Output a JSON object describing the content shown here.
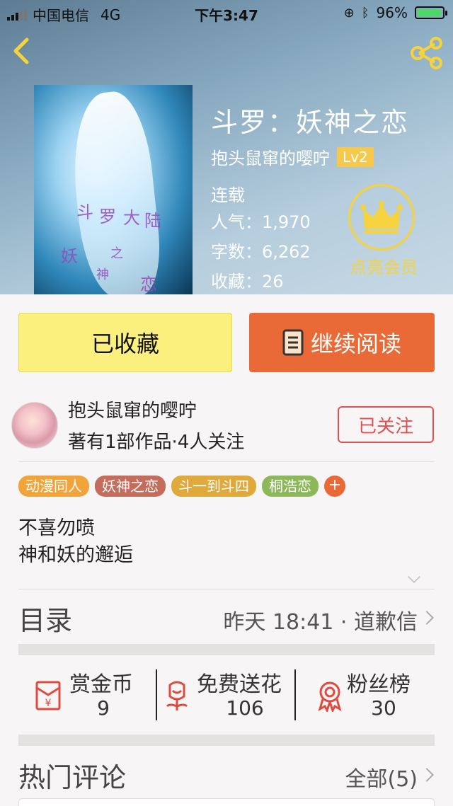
{
  "status_bar": {
    "carrier": "中国电信",
    "network": "4G",
    "time": "下午3:47",
    "battery": "96%",
    "battery_level": 0.96
  },
  "book": {
    "title": "斗罗：妖神之恋",
    "author": "抱头鼠窜的嘤咛",
    "level": "Lv2",
    "status": "连载",
    "popularity": "人气：1,970",
    "words": "字数：6,262",
    "favorites": "收藏：26",
    "vip_label": "点亮会员",
    "cover_text": [
      "斗",
      "罗",
      "大",
      "陆",
      "妖",
      "神",
      "之",
      "恋"
    ]
  },
  "actions": {
    "favorite": "已收藏",
    "continue": "继续阅读"
  },
  "author_card": {
    "name": "抱头鼠窜的嘤咛",
    "stats": "著有1部作品·4人关注",
    "follow": "已关注"
  },
  "tags": [
    {
      "label": "动漫同人",
      "color": "#f1a43a"
    },
    {
      "label": "妖神之恋",
      "color": "#c56d5d"
    },
    {
      "label": "斗一到斗四",
      "color": "#e0a93c"
    },
    {
      "label": "桐浩恋",
      "color": "#8cb859"
    }
  ],
  "tag_add": "+",
  "description": [
    "不喜勿喷",
    "神和妖的邂逅"
  ],
  "toc": {
    "title": "目录",
    "info": "昨天 18:41 · 道歉信"
  },
  "stats": [
    {
      "label": "赏金币",
      "value": "9",
      "icon": "red-envelope-icon"
    },
    {
      "label": "免费送花",
      "value": "106",
      "icon": "flower-icon"
    },
    {
      "label": "粉丝榜",
      "value": "30",
      "icon": "medal-icon"
    }
  ],
  "comments": {
    "title": "热门评论",
    "all": "全部(5)"
  }
}
